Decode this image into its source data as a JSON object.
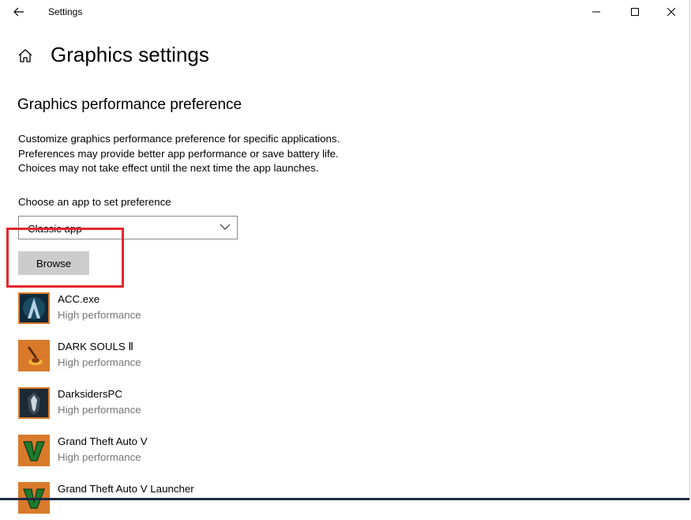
{
  "window": {
    "title": "Settings"
  },
  "page": {
    "title": "Graphics settings"
  },
  "section": {
    "title": "Graphics performance preference",
    "description_lines": [
      "Customize graphics performance preference for specific applications.",
      "Preferences may provide better app performance or save battery life.",
      "Choices may not take effect until the next time the app launches."
    ]
  },
  "chooser": {
    "label": "Choose an app to set preference",
    "selected": "Classic app",
    "browse_label": "Browse"
  },
  "apps": [
    {
      "name": "ACC.exe",
      "preference": "High performance",
      "icon": "assassins-creed-icon"
    },
    {
      "name": "DARK SOULS Ⅱ",
      "preference": "High performance",
      "icon": "dark-souls-icon"
    },
    {
      "name": "DarksidersPC",
      "preference": "High performance",
      "icon": "darksiders-icon"
    },
    {
      "name": "Grand Theft Auto V",
      "preference": "High performance",
      "icon": "gta-v-icon"
    },
    {
      "name": "Grand Theft Auto V Launcher",
      "preference": "",
      "icon": "gta-v-launcher-icon"
    }
  ],
  "colors": {
    "highlight_box": "#e3262f",
    "browse_button": "#cccccc",
    "secondary_text": "#767676",
    "icon_orange": "#d97a2b"
  }
}
